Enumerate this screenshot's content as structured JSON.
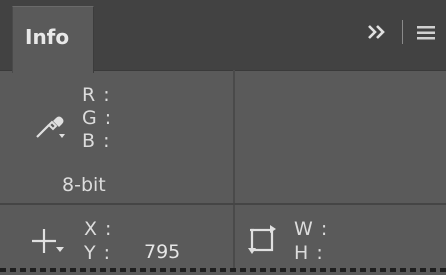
{
  "panel": {
    "tab_label": "Info"
  },
  "color_readout": {
    "r_label": "R :",
    "g_label": "G :",
    "b_label": "B :",
    "bit_depth": "8-bit"
  },
  "position_readout": {
    "x_label": "X :",
    "y_label": "Y :",
    "y_value": "795"
  },
  "size_readout": {
    "w_label": "W :",
    "h_label": "H :"
  },
  "icons": {
    "collapse": "double-chevron-right-icon",
    "menu": "hamburger-menu-icon",
    "eyedropper": "eyedropper-icon",
    "crosshair": "crosshair-icon",
    "selection": "selection-bounds-icon"
  }
}
